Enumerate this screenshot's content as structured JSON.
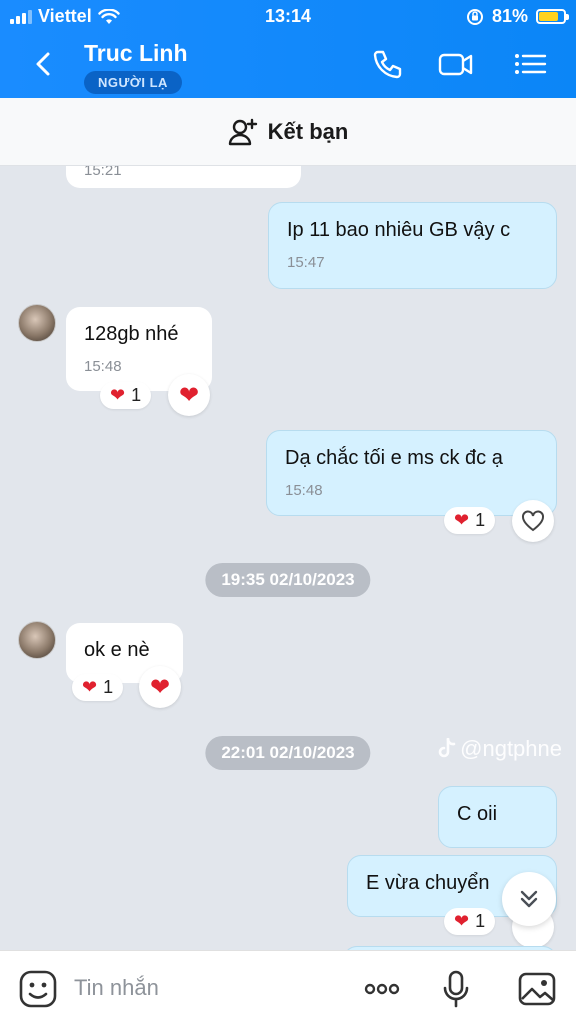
{
  "status": {
    "carrier": "Viettel",
    "time": "13:14",
    "battery": "81%",
    "battery_level": 0.81
  },
  "header": {
    "title": "Truc Linh",
    "badge": "NGƯỜI LẠ"
  },
  "friend_bar": {
    "label": "Kết bạn"
  },
  "messages": [
    {
      "time": "15:21"
    },
    {
      "text": "Ip 11 bao nhiêu GB vậy c",
      "time": "15:47"
    },
    {
      "text": "128gb nhé",
      "time": "15:48",
      "reaction_count": "1"
    },
    {
      "text": "Dạ chắc tối e ms ck đc ạ",
      "time": "15:48",
      "reaction_count": "1"
    },
    {
      "text": "ok e nè",
      "reaction_count": "1"
    },
    {
      "text": "C oii"
    },
    {
      "text": "E vừa chuyển",
      "reaction_count": "1"
    }
  ],
  "stamps": {
    "first": "19:35 02/10/2023",
    "second": "22:01 02/10/2023"
  },
  "watermark": "@ngtphne",
  "composer": {
    "placeholder": "Tin nhắn"
  },
  "colors": {
    "header": "#0b86f7",
    "outgoing_bubble": "#d5f1ff",
    "incoming_bubble": "#ffffff",
    "background": "#e2e6ec"
  }
}
